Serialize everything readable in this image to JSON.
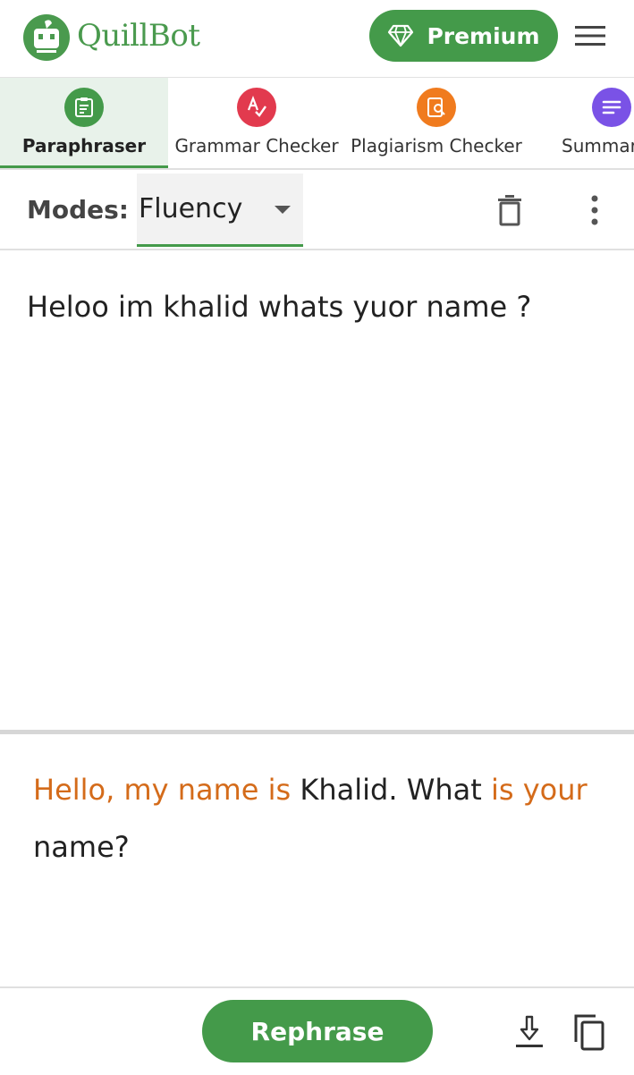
{
  "header": {
    "logo_text": "QuillBot",
    "premium_label": "Premium"
  },
  "tabs": [
    {
      "label": "Paraphraser",
      "color": "#449a4a",
      "active": true
    },
    {
      "label": "Grammar Checker",
      "color": "#e23a4e",
      "active": false
    },
    {
      "label": "Plagiarism Checker",
      "color": "#f07b1e",
      "active": false
    },
    {
      "label": "Summarizer",
      "color": "#7a52e6",
      "active": false
    }
  ],
  "modes": {
    "label": "Modes:",
    "selected": "Fluency"
  },
  "input": {
    "text": "Heloo im khalid whats yuor name ?"
  },
  "output": {
    "segments": [
      {
        "text": "Hello, my name is",
        "changed": true
      },
      {
        "text": " Khalid. What ",
        "changed": false
      },
      {
        "text": "is your",
        "changed": true
      },
      {
        "text": " name?",
        "changed": false
      }
    ]
  },
  "actions": {
    "rephrase_label": "Rephrase"
  },
  "colors": {
    "brand_green": "#449a4a",
    "changed_orange": "#d46b1a"
  }
}
